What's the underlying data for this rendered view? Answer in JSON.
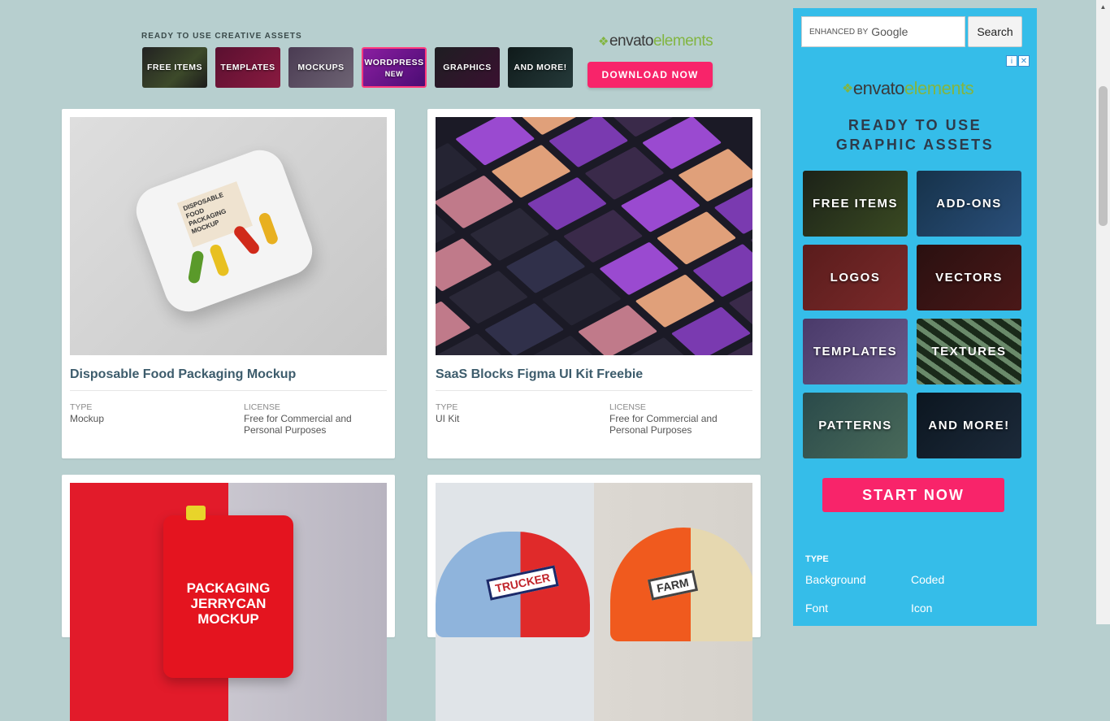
{
  "banner": {
    "title": "READY TO USE CREATIVE ASSETS",
    "tiles": [
      {
        "label": "FREE ITEMS",
        "sub": ""
      },
      {
        "label": "TEMPLATES",
        "sub": ""
      },
      {
        "label": "MOCKUPS",
        "sub": ""
      },
      {
        "label": "WORDPRESS",
        "sub": "NEW"
      },
      {
        "label": "GRAPHICS",
        "sub": ""
      },
      {
        "label": "AND MORE!",
        "sub": ""
      }
    ],
    "logo_text": "envato",
    "logo_text_accent": "elements",
    "download_label": "DOWNLOAD NOW"
  },
  "cards": [
    {
      "title": "Disposable Food Packaging Mockup",
      "type_label": "TYPE",
      "type_value": "Mockup",
      "license_label": "LICENSE",
      "license_value": "Free for Commercial and Personal Purposes",
      "image_text": "DISPOSABLE FOOD PACKAGING MOCKUP"
    },
    {
      "title": "SaaS Blocks Figma UI Kit Freebie",
      "type_label": "TYPE",
      "type_value": "UI Kit",
      "license_label": "LICENSE",
      "license_value": "Free for Commercial and Personal Purposes"
    },
    {
      "title": "",
      "image_text": "PACKAGING JERRYCAN MOCKUP"
    },
    {
      "title": "",
      "image_text_left": "TRUCKER",
      "image_text_right": "FARM"
    }
  ],
  "sidebar": {
    "search_placeholder_prefix": "ENHANCED BY",
    "search_placeholder_brand": "Google",
    "search_button": "Search",
    "ad_info": "i",
    "ad_close": "✕",
    "logo_text": "envato",
    "logo_text_accent": "elements",
    "heading_line1": "READY TO USE",
    "heading_line2": "GRAPHIC ASSETS",
    "tiles": [
      "FREE ITEMS",
      "ADD-ONS",
      "LOGOS",
      "VECTORS",
      "TEMPLATES",
      "TEXTURES",
      "PATTERNS",
      "AND MORE!"
    ],
    "start_label": "START NOW",
    "type_heading": "TYPE",
    "type_links": [
      "Background",
      "Coded",
      "Font",
      "Icon"
    ]
  },
  "colors": {
    "accent": "#f8246a",
    "sidebar_bg": "#35bde9",
    "page_bg": "#b7cfcf",
    "envato_green": "#82b541"
  }
}
